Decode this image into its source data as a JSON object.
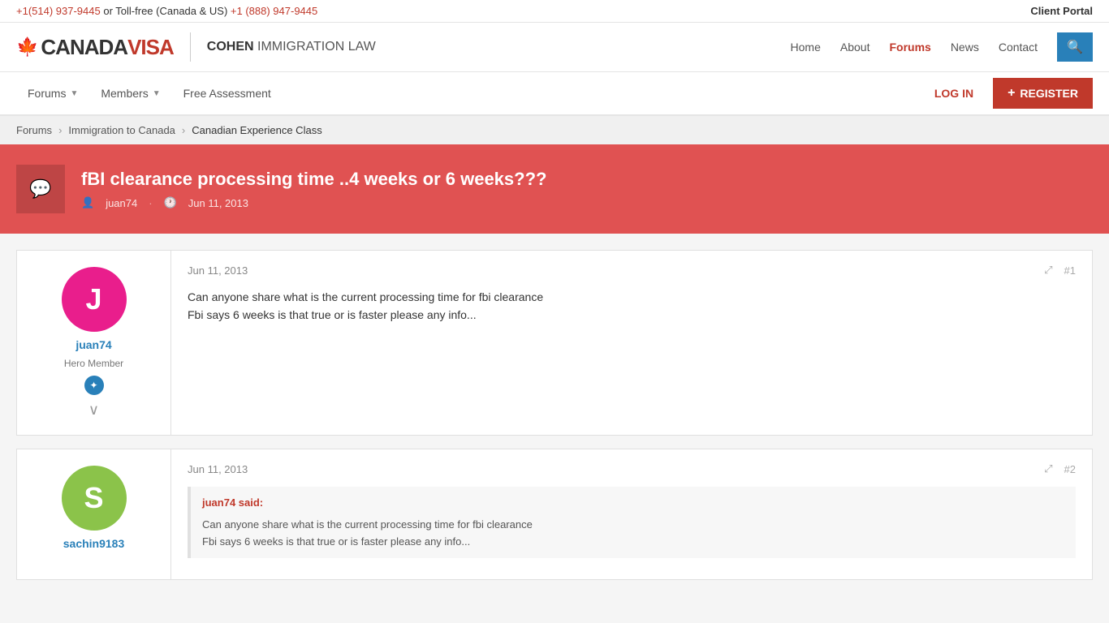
{
  "topbar": {
    "phone1": "+1(514) 937-9445",
    "or_text": " or Toll-free (Canada & US) ",
    "phone2": "+1 (888) 947-9445",
    "client_portal": "Client Portal"
  },
  "header": {
    "logo": {
      "maple": "🍁",
      "canada": "CANADA",
      "visa": "VISA",
      "cohen": "COHEN",
      "immigration_law": " IMMIGRATION LAW"
    },
    "nav": {
      "home": "Home",
      "about": "About",
      "forums": "Forums",
      "news": "News",
      "contact": "Contact"
    },
    "search_icon": "🔍"
  },
  "navbar": {
    "forums": "Forums",
    "members": "Members",
    "free_assessment": "Free Assessment",
    "login": "LOG IN",
    "register": "REGISTER",
    "plus": "+"
  },
  "breadcrumb": {
    "forums": "Forums",
    "immigration_to_canada": "Immigration to Canada",
    "current": "Canadian Experience Class"
  },
  "thread": {
    "icon": "💬",
    "title": "fBI clearance processing time ..4 weeks or 6 weeks???",
    "author": "juan74",
    "date": "Jun 11, 2013"
  },
  "posts": [
    {
      "id": "1",
      "avatar_letter": "J",
      "avatar_class": "avatar-j",
      "username": "juan74",
      "role": "Hero Member",
      "date": "Jun 11, 2013",
      "post_num": "#1",
      "lines": [
        "Can anyone share what is the current processing time for fbi clearance",
        "Fbi says 6 weeks is that true or is faster please any info..."
      ],
      "has_badge": true,
      "has_expand": true,
      "quote": null
    },
    {
      "id": "2",
      "avatar_letter": "S",
      "avatar_class": "avatar-s",
      "username": "sachin9183",
      "role": "",
      "date": "Jun 11, 2013",
      "post_num": "#2",
      "lines": [],
      "has_badge": false,
      "has_expand": false,
      "quote": {
        "author": "juan74 said:",
        "lines": [
          "Can anyone share what is the current processing time for fbi clearance",
          "Fbi says 6 weeks is that true or is faster please any info..."
        ]
      }
    }
  ]
}
